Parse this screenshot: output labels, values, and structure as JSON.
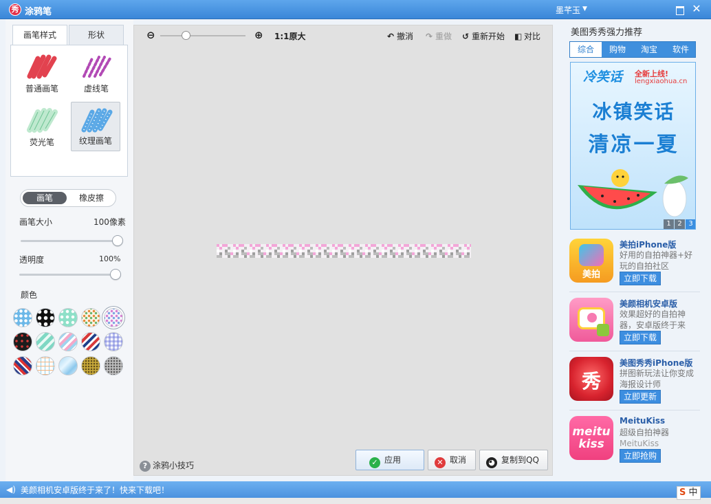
{
  "window": {
    "title": "涂鸦笔",
    "logo_char": "秀",
    "user": "墨芊玉"
  },
  "left": {
    "tabs": [
      {
        "label": "画笔样式"
      },
      {
        "label": "形状"
      }
    ],
    "brushes": [
      {
        "label": "普通画笔",
        "color": "#e2424f"
      },
      {
        "label": "虚线笔",
        "color": "#b24ab5"
      },
      {
        "label": "荧光笔",
        "color": "#9bd8b2"
      },
      {
        "label": "纹理画笔",
        "color": "#5aa8e6"
      }
    ],
    "mode": {
      "on": "画笔",
      "off": "橡皮擦"
    },
    "size_label": "画笔大小",
    "size_value": "100像素",
    "opacity_label": "透明度",
    "opacity_value": "100%",
    "color_label": "颜色"
  },
  "canvas": {
    "zoom_label": "1:1原大",
    "undo": "撤消",
    "redo": "重做",
    "reset": "重新开始",
    "compare": "对比",
    "tips": "涂鸦小技巧",
    "apply": "应用",
    "cancel": "取消",
    "copy_qq": "复制到QQ"
  },
  "right": {
    "title": "美图秀秀强力推荐",
    "tabs": [
      {
        "label": "综合"
      },
      {
        "label": "购物"
      },
      {
        "label": "淘宝"
      },
      {
        "label": "软件"
      }
    ],
    "banner": {
      "site_name": "冷笑话",
      "site_tag": "全新上线!",
      "site_url": "lengxiaohua.cn",
      "line1": "冰镇笑话",
      "line2": "清凉一夏",
      "pages": [
        "1",
        "2",
        "3"
      ]
    },
    "apps": [
      {
        "name": "美拍iPhone版",
        "desc": "好用的自拍神器+好玩的自拍社区",
        "button": "立即下载",
        "icon_text": "美拍"
      },
      {
        "name": "美颜相机安卓版",
        "desc": "效果超好的自拍神器，安卓版终于来",
        "button": "立即下载",
        "icon_text": ""
      },
      {
        "name": "美图秀秀iPhone版",
        "desc": "拼图新玩法让你变成海报设计师",
        "button": "立即更新",
        "icon_text": "秀"
      },
      {
        "name": "MeituKiss",
        "desc": "超级自拍神器",
        "desc2": "MeituKiss",
        "button": "立即抢购",
        "icon_text": "meitu kiss"
      }
    ]
  },
  "status": {
    "message": "美颜相机安卓版终于来了！快来下载吧！",
    "ime_logo": "S",
    "ime_lang": "中"
  },
  "colors": {
    "accent": "#3d8ee0",
    "titlebar": "#4a95e2"
  }
}
